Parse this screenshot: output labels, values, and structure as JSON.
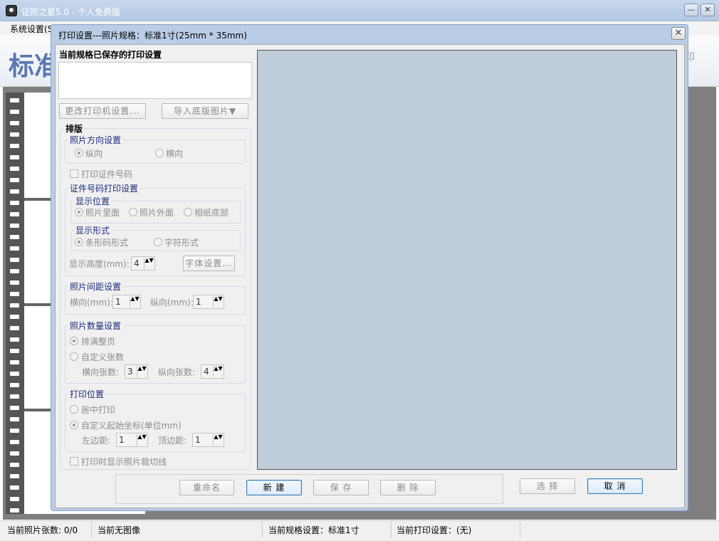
{
  "main": {
    "title": "证照之星5.0 - 个人免费版",
    "menu_first": "系统设置(S)",
    "banner_text": "标准",
    "right_hint": "印",
    "min_label": "—",
    "close_label": "✕"
  },
  "status": {
    "photo_count": "当前照片张数: 0/0",
    "image": "当前无图像",
    "spec": "当前规格设置：标准1寸",
    "print_setting": "当前打印设置：(无)"
  },
  "dialog": {
    "title": "打印设置---照片规格：标准1寸(25mm * 35mm)",
    "close": "✕",
    "saved_header": "当前规格已保存的打印设置",
    "change_printer": "更改打印机设置...",
    "import_base": "导入底版图片▼",
    "layout": "排版",
    "orientation_group": "照片方向设置",
    "portrait": "纵向",
    "landscape": "横向",
    "print_id": "打印证件号码",
    "id_print_group": "证件号码打印设置",
    "display_pos": "显示位置",
    "pos_inside": "照片里面",
    "pos_outside": "照片外面",
    "pos_bottom": "相纸底部",
    "display_form": "显示形式",
    "barcode": "条形码形式",
    "charform": "字符形式",
    "display_height": "显示高度(mm):",
    "display_height_value": "4",
    "font_setting": "字体设置...",
    "spacing_group": "照片间距设置",
    "h_spacing": "横向(mm):",
    "h_spacing_value": "1",
    "v_spacing": "纵向(mm):",
    "v_spacing_value": "1",
    "count_group": "照片数量设置",
    "fill_page": "排满整页",
    "custom_count": "自定义张数",
    "h_count": "横向张数:",
    "h_count_value": "3",
    "v_count": "纵向张数:",
    "v_count_value": "4",
    "position_group": "打印位置",
    "center_print": "居中打印",
    "custom_origin": "自定义起始坐标(单位mm)",
    "left_margin": "左边距:",
    "left_margin_value": "1",
    "top_margin": "顶边距:",
    "top_margin_value": "1",
    "show_cutline": "打印时显示照片裁切线",
    "rename": "重命名",
    "new": "新  建",
    "save": "保  存",
    "delete": "删  除",
    "select": "选  择",
    "cancel": "取  消",
    "spin_arrows": "▲▼"
  }
}
